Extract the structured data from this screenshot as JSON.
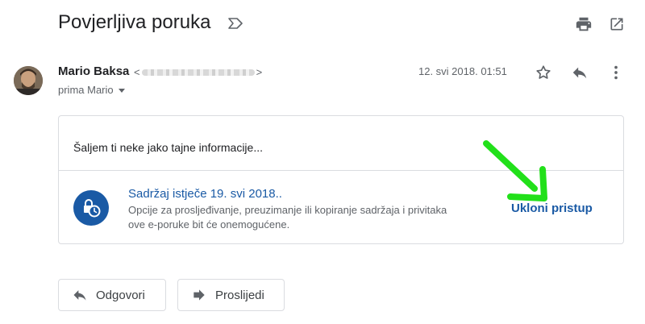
{
  "header": {
    "subject": "Povjerljiva poruka",
    "icons": {
      "label": "important-label-icon",
      "print": "print-icon",
      "open_new": "open-in-new-window-icon"
    }
  },
  "message": {
    "sender_name": "Mario Baksa",
    "email_open": "<",
    "email_close": ">",
    "recipient": "prima Mario",
    "date": "12. svi 2018. 01:51",
    "actions": {
      "star": "star-icon",
      "reply": "reply-icon",
      "more": "more-vertical-icon"
    }
  },
  "body": {
    "text": "Šaljem ti neke jako tajne informacije...",
    "confidential": {
      "title": "Sadržaj istječe 19. svi 2018..",
      "description": "Opcije za prosljeđivanje, preuzimanje ili kopiranje sadržaja i privitaka ove e-poruke bit će onemogućene.",
      "remove_access": "Ukloni pristup",
      "icon": "expiring-clock-lock-icon"
    }
  },
  "footer": {
    "reply_label": "Odgovori",
    "forward_label": "Proslijedi"
  },
  "colors": {
    "accent_blue": "#1a5aa5",
    "annotation_arrow": "#22e01a",
    "border": "#dadce0",
    "muted_text": "#5f6368"
  }
}
